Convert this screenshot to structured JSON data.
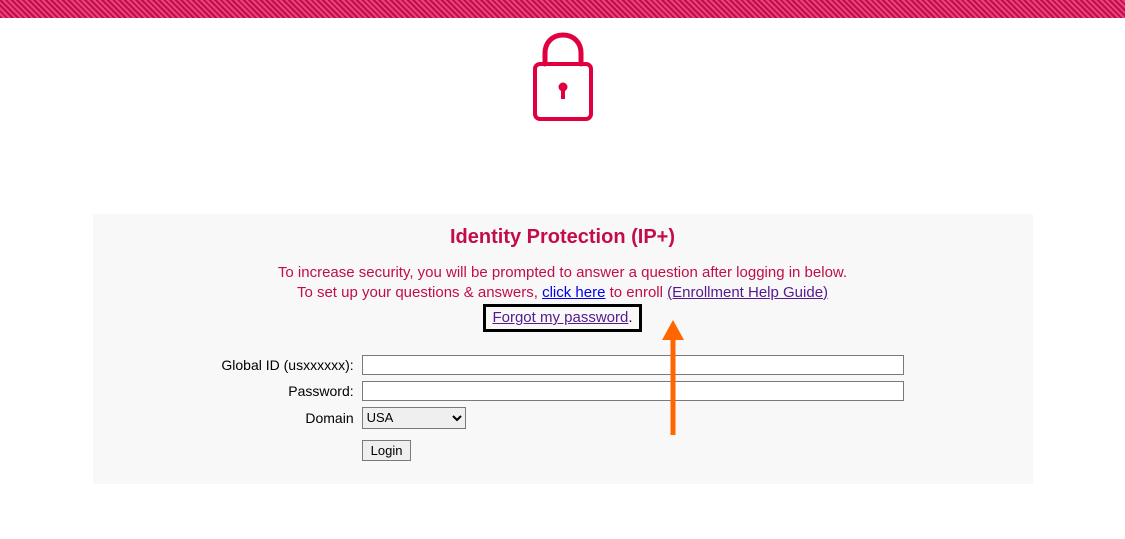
{
  "colors": {
    "brand": "#c20d4a",
    "arrow": "#ff6600"
  },
  "heading": "Identity Protection (IP+)",
  "instruction": {
    "line1": "To increase security, you will be prompted to answer a question after logging in below.",
    "line2_prefix": "To set up your questions & answers, ",
    "click_here": "click here",
    "line2_mid": " to enroll ",
    "enroll_guide": "(Enrollment Help Guide)"
  },
  "forgot": {
    "link": "Forgot my password",
    "suffix": "."
  },
  "form": {
    "global_id_label": "Global ID (usxxxxxx):",
    "global_id_value": "",
    "password_label": "Password:",
    "password_value": "",
    "domain_label": "Domain",
    "domain_selected": "USA",
    "login_button": "Login"
  },
  "icons": {
    "lock": "lock-icon"
  }
}
